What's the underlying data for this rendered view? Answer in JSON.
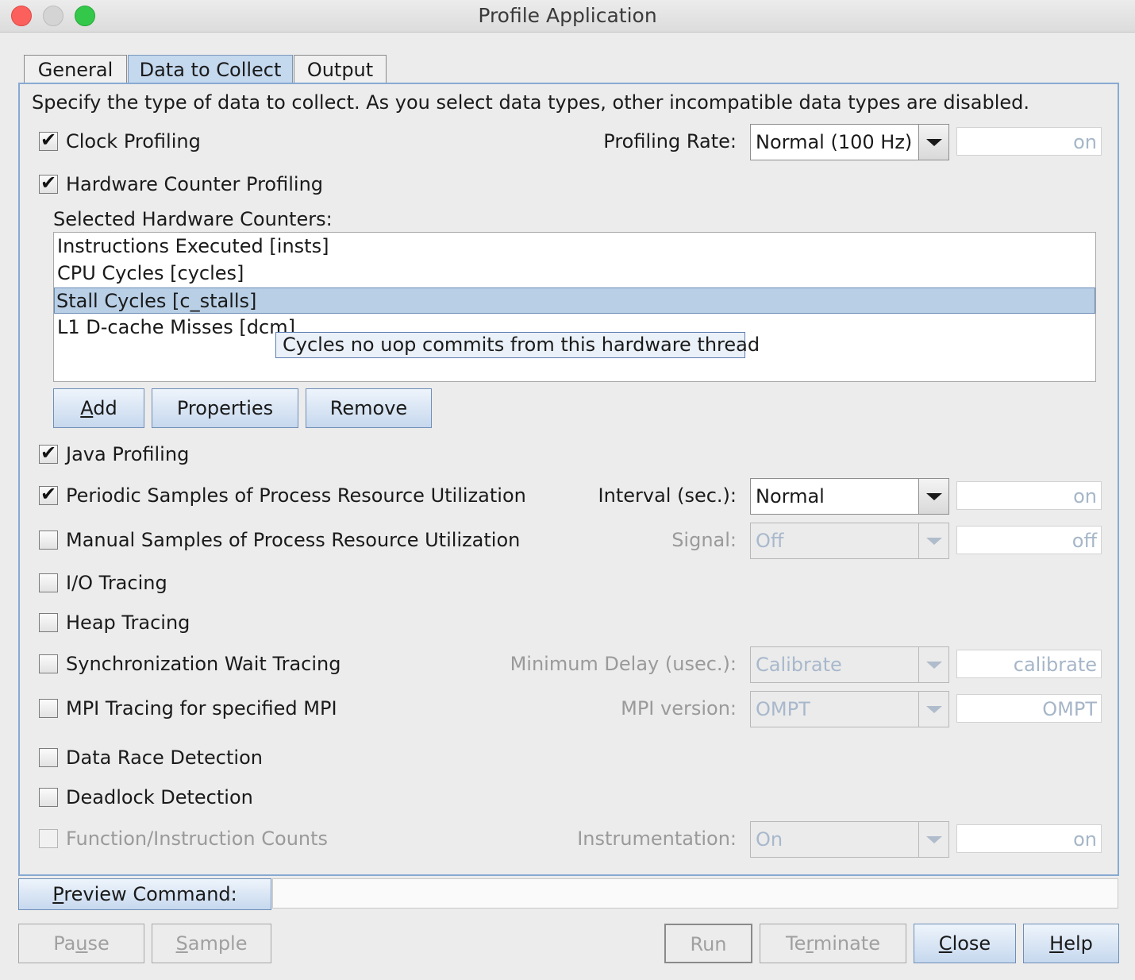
{
  "window": {
    "title": "Profile Application"
  },
  "tabs": [
    {
      "label": "General",
      "active": false
    },
    {
      "label": "Data to Collect",
      "active": true
    },
    {
      "label": "Output",
      "active": false
    }
  ],
  "description": "Specify the type of data to collect.  As you select data types, other incompatible data types are disabled.",
  "options": {
    "clock": {
      "label": "Clock Profiling",
      "checked": true,
      "setting_label": "Profiling Rate:",
      "setting_value": "Normal (100 Hz)",
      "field_value": "on"
    },
    "hwc": {
      "label": "Hardware Counter Profiling",
      "checked": true
    },
    "java": {
      "label": "Java Profiling",
      "checked": true
    },
    "periodic": {
      "label": "Periodic Samples of Process Resource Utilization",
      "checked": true,
      "setting_label": "Interval (sec.):",
      "setting_value": "Normal",
      "field_value": "on"
    },
    "manual": {
      "label": "Manual Samples of Process Resource Utilization",
      "checked": false,
      "setting_label": "Signal:",
      "setting_value": "Off",
      "field_value": "off"
    },
    "io": {
      "label": "I/O Tracing",
      "checked": false
    },
    "heap": {
      "label": "Heap Tracing",
      "checked": false
    },
    "sync": {
      "label": "Synchronization Wait Tracing",
      "checked": false,
      "setting_label": "Minimum Delay (usec.):",
      "setting_value": "Calibrate",
      "field_value": "calibrate"
    },
    "mpi": {
      "label": "MPI Tracing for specified MPI",
      "checked": false,
      "setting_label": "MPI version:",
      "setting_value": "OMPT",
      "field_value": "OMPT"
    },
    "race": {
      "label": "Data Race Detection",
      "checked": false
    },
    "deadlock": {
      "label": "Deadlock Detection",
      "checked": false
    },
    "count": {
      "label": "Function/Instruction Counts",
      "checked": false,
      "disabled": true,
      "setting_label": "Instrumentation:",
      "setting_value": "On",
      "field_value": "on"
    }
  },
  "hw_counters": {
    "label": "Selected Hardware Counters:",
    "items": [
      {
        "text": "Instructions Executed  [insts]",
        "selected": false
      },
      {
        "text": "CPU Cycles  [cycles]",
        "selected": false
      },
      {
        "text": "Stall Cycles  [c_stalls]",
        "selected": true
      },
      {
        "text": "L1 D-cache Misses  [dcm]",
        "selected": false
      }
    ],
    "tooltip": "Cycles no uop commits from this hardware thread",
    "buttons": {
      "add_rest": "dd",
      "add_mnemonic": "A",
      "properties": "Properties",
      "remove": "Remove"
    }
  },
  "preview": {
    "mnemonic": "P",
    "rest": "review Command:",
    "value": ""
  },
  "footer": {
    "pause_pre": "Pa",
    "pause_mn": "u",
    "pause_post": "se",
    "sample_mn": "S",
    "sample_post": "ample",
    "run": "Run",
    "terminate_pre": "Te",
    "terminate_mn": "r",
    "terminate_post": "minate",
    "close_mn": "C",
    "close_post": "lose",
    "help_mn": "H",
    "help_post": "elp"
  }
}
